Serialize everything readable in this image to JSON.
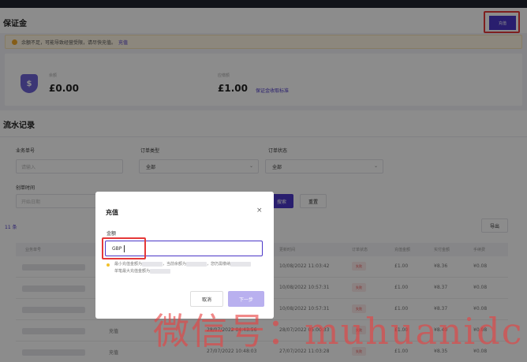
{
  "header": {
    "title": "保证金",
    "recharge_label": "充值"
  },
  "notice": {
    "text": "余额不足，可能导致经营受限，请尽快充值。",
    "link": "充值"
  },
  "balance": {
    "balance_label": "余额",
    "balance_value": "£0.00",
    "deposit_label": "应缴额",
    "deposit_value": "£1.00",
    "standard_link": "保证金收取标准"
  },
  "records": {
    "title": "流水记录",
    "filters": {
      "biz_no_label": "业务单号",
      "biz_no_placeholder": "请输入",
      "order_type_label": "订单类型",
      "order_type_value": "全部",
      "order_status_label": "订单状态",
      "order_status_value": "全部",
      "created_label": "创单时间",
      "created_placeholder": "开始日期"
    },
    "search_label": "搜索",
    "reset_label": "重置",
    "count": "11 条",
    "export_label": "导出",
    "columns": [
      "业务单号",
      "",
      "",
      "更新时间",
      "订单状态",
      "充值金额",
      "实付金额",
      "手续费"
    ],
    "rows": [
      {
        "type": "",
        "created": "",
        "updated": "10/08/2022 11:03:42",
        "status": "失败",
        "amount": "£1.00",
        "paid": "¥8.36",
        "fee": "¥0.08"
      },
      {
        "type": "",
        "created": "",
        "updated": "10/08/2022 10:57:31",
        "status": "失败",
        "amount": "£1.00",
        "paid": "¥8.37",
        "fee": "¥0.08"
      },
      {
        "type": "",
        "created": "",
        "updated": "10/08/2022 10:57:31",
        "status": "失败",
        "amount": "£1.00",
        "paid": "¥8.37",
        "fee": "¥0.08"
      },
      {
        "type": "充值",
        "created": "28/07/2022 04:43:56",
        "updated": "28/07/2022 05:00:33",
        "status": "失败",
        "amount": "£1.00",
        "paid": "¥8.40",
        "fee": "¥0.08"
      },
      {
        "type": "充值",
        "created": "27/07/2022 10:48:03",
        "updated": "27/07/2022 11:03:28",
        "status": "失败",
        "amount": "£1.00",
        "paid": "¥8.35",
        "fee": "¥0.08"
      }
    ]
  },
  "modal": {
    "title": "充值",
    "close": "×",
    "amount_label": "金额",
    "amount_value": "GBP",
    "tip1a": "最小充值金额为",
    "tip1b": "，当前余额为",
    "tip1c": "，您仍需缴纳",
    "tip2": "单笔最大充值金额为",
    "cancel_label": "取消",
    "next_label": "下一步"
  },
  "watermark": "微信号：muhuanidc",
  "colors": {
    "accent": "#4b37c8",
    "highlight": "#e53939",
    "watermark": "#e84040"
  }
}
